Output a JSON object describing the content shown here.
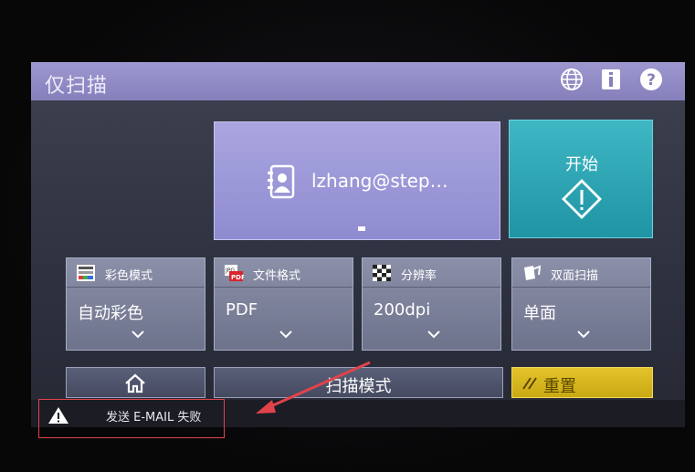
{
  "header": {
    "title": "仅扫描",
    "icons": [
      "globe-icon",
      "info-icon",
      "help-icon"
    ]
  },
  "destination": {
    "text": "lzhang@step…",
    "icon": "address-book-icon"
  },
  "start": {
    "label": "开始",
    "icon": "start-diamond-icon",
    "color": "#2aa6b5"
  },
  "settings": [
    {
      "label": "彩色模式",
      "value": "自动彩色",
      "icon": "color-mode-icon"
    },
    {
      "label": "文件格式",
      "value": "PDF",
      "icon": "file-format-icon"
    },
    {
      "label": "分辨率",
      "value": "200dpi",
      "icon": "resolution-icon"
    },
    {
      "label": "双面扫描",
      "value": "单面",
      "icon": "duplex-icon"
    }
  ],
  "bottom": {
    "home_icon": "home-icon",
    "mode_label": "扫描模式",
    "reset_label": "重置",
    "reset_color": "#d8b81f"
  },
  "status": {
    "message": "发送 E-MAIL 失败",
    "icon": "warning-icon"
  }
}
